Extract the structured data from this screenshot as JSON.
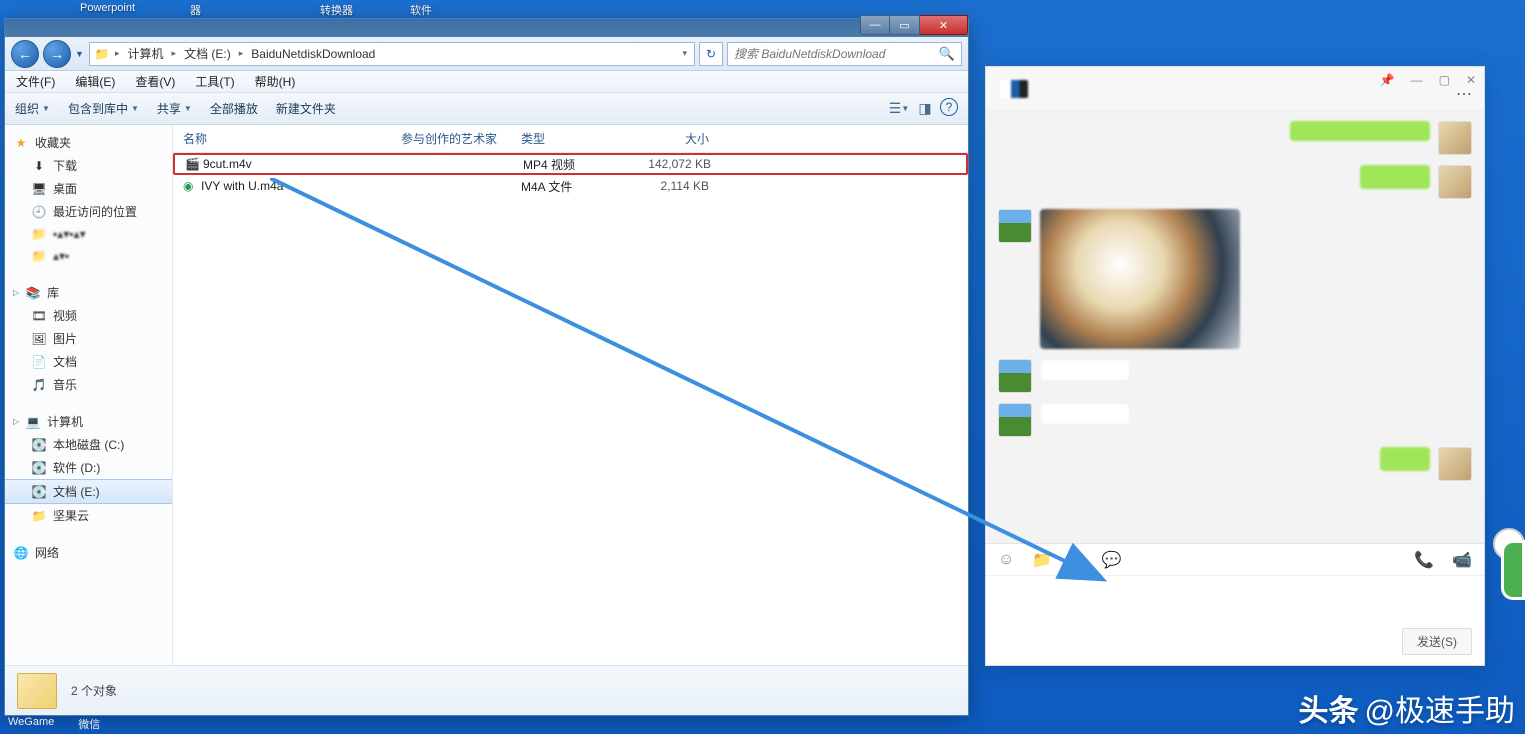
{
  "desktop": {
    "icons": [
      "Powerpoint",
      "器",
      "转换器",
      "软件"
    ]
  },
  "explorer": {
    "breadcrumb": [
      "计算机",
      "文档 (E:)",
      "BaiduNetdiskDownload"
    ],
    "search_placeholder": "搜索 BaiduNetdiskDownload",
    "menus": [
      "文件(F)",
      "编辑(E)",
      "查看(V)",
      "工具(T)",
      "帮助(H)"
    ],
    "toolbar": {
      "organize": "组织",
      "include": "包含到库中",
      "share": "共享",
      "playall": "全部播放",
      "newfolder": "新建文件夹"
    },
    "nav": {
      "favorites": "收藏夹",
      "downloads": "下载",
      "desktop": "桌面",
      "recent": "最近访问的位置",
      "library": "库",
      "videos": "视频",
      "pictures": "图片",
      "documents": "文档",
      "music": "音乐",
      "computer": "计算机",
      "driveC": "本地磁盘 (C:)",
      "driveD": "软件 (D:)",
      "driveE": "文档 (E:)",
      "jianguo": "坚果云",
      "network": "网络"
    },
    "columns": {
      "name": "名称",
      "artist": "参与创作的艺术家",
      "type": "类型",
      "size": "大小"
    },
    "files": [
      {
        "name": "9cut.m4v",
        "type": "MP4 视频",
        "size": "142,072 KB"
      },
      {
        "name": "IVY with U.m4a",
        "type": "M4A 文件",
        "size": "2,114 KB"
      }
    ],
    "status": "2 个对象"
  },
  "chat": {
    "send": "发送(S)"
  },
  "watermark": {
    "brand": "头条",
    "author": "@极速手助"
  },
  "taskbar": [
    "WeGame",
    "微信"
  ]
}
